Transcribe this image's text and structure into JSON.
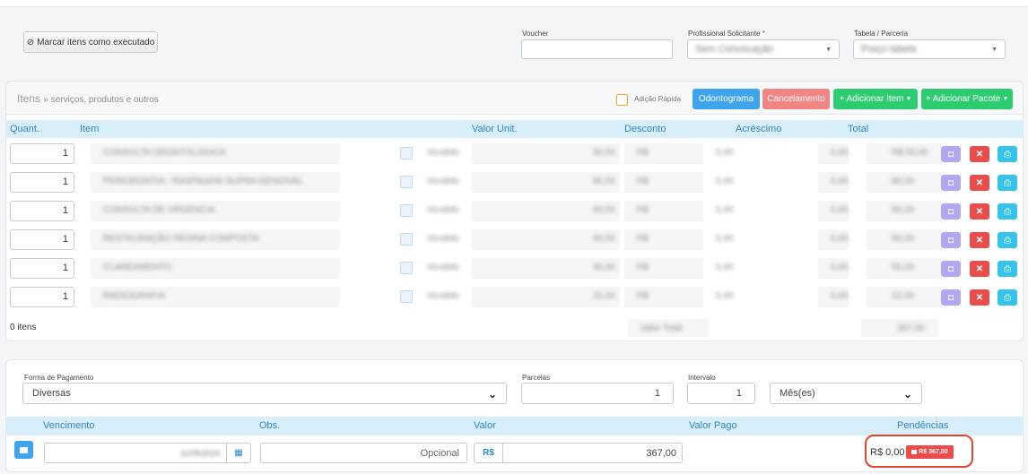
{
  "header": {
    "mark_button": "Marcar itens como executado",
    "voucher_label": "Voucher",
    "voucher_value": "",
    "profissional_label": "Profissional Solicitante",
    "profissional_required": "*",
    "profissional_value": "Sem Convocação",
    "tabela_label": "Tabela / Parceria",
    "tabela_value": "Preço tabela"
  },
  "items": {
    "title": "Itens",
    "subtitle": "» serviços, produtos e outros",
    "quick_add_label": "Adição Rápida",
    "buttons": {
      "odontograma": "Odontograma",
      "cancelamento": "Cancelamento",
      "adicionar_item": "+ Adicionar Item",
      "adicionar_pacote": "+ Adicionar Pacote"
    },
    "columns": [
      "Quant.",
      "Item",
      "Valor Unit.",
      "Desconto",
      "Acréscimo",
      "Total"
    ],
    "rows": [
      {
        "qty": "1",
        "item": "CONSULTA ODONTOLOGICA",
        "status": "Vendido",
        "unit": "50,00",
        "disc": "R$",
        "add": "0,00",
        "tot": "0,00",
        "total": "R$ 50,00"
      },
      {
        "qty": "1",
        "item": "PERIODONTIA - RASPAGEM SUPRA GENGIVAL",
        "status": "Vendido",
        "unit": "80,00",
        "disc": "R$",
        "add": "0,00",
        "tot": "0,00",
        "total": "80,00"
      },
      {
        "qty": "1",
        "item": "CONSULTA DE URGENCIA",
        "status": "Vendido",
        "unit": "60,00",
        "disc": "R$",
        "add": "0,00",
        "tot": "0,00",
        "total": "60,00"
      },
      {
        "qty": "1",
        "item": "RESTAURAÇÃO RESINA COMPOSTA",
        "status": "Vendido",
        "unit": "60,00",
        "disc": "R$",
        "add": "0,00",
        "tot": "0,00",
        "total": "60,00"
      },
      {
        "qty": "1",
        "item": "CLAREAMENTO",
        "status": "Vendido",
        "unit": "95,00",
        "disc": "R$",
        "add": "0,00",
        "tot": "0,00",
        "total": "95,00"
      },
      {
        "qty": "1",
        "item": "RADIOGRAFIA",
        "status": "Vendido",
        "unit": "22,00",
        "disc": "R$",
        "add": "0,00",
        "tot": "0,00",
        "total": "22,00"
      }
    ],
    "count_label": "0 itens",
    "footer_total_label": "Valor Total",
    "footer_total": "367,00"
  },
  "payment": {
    "forma_label": "Forma de Pagamento",
    "forma_value": "Diversas",
    "parcelas_label": "Parcelas",
    "parcelas_value": "1",
    "intervalo_label": "Intervalo",
    "intervalo_value": "1",
    "periodo_value": "Mês(es)",
    "columns": [
      "Vencimento",
      "Obs.",
      "Valor",
      "Valor Pago",
      "Pendências"
    ],
    "vencimento_value": "11/09/2024",
    "obs_placeholder": "Opcional",
    "currency": "R$",
    "valor_value": "367,00",
    "pendencia_value": "R$ 0,00",
    "pendencia_badge": "R$ 367,00"
  },
  "colors": {
    "odontograma": "#3ea4ec",
    "cancelamento": "#f08584",
    "green": "#2ecc71",
    "header_bg": "#d8eef9",
    "header_text": "#2d87c7",
    "purple": "#b3a7f1",
    "red": "#ea4c4c",
    "cyan": "#35c3ec",
    "highlight": "#e0452f"
  }
}
